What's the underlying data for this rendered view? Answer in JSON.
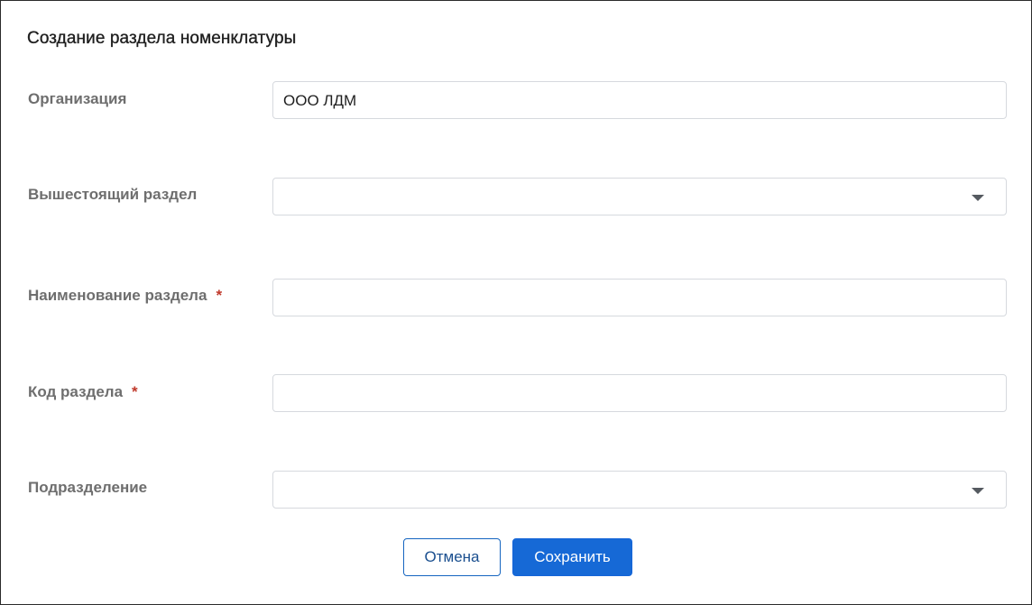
{
  "dialog": {
    "title": "Создание раздела номенклатуры"
  },
  "form": {
    "organization": {
      "label": "Организация",
      "value": "ООО ЛДМ"
    },
    "parent_section": {
      "label": "Вышестоящий раздел",
      "value": "",
      "icon": "chevron-down-icon"
    },
    "section_name": {
      "label": "Наименование раздела",
      "required_mark": "*",
      "value": ""
    },
    "section_code": {
      "label": "Код раздела",
      "required_mark": "*",
      "value": ""
    },
    "department": {
      "label": "Подразделение",
      "value": "",
      "icon": "chevron-down-icon"
    }
  },
  "actions": {
    "cancel_label": "Отмена",
    "save_label": "Сохранить"
  },
  "colors": {
    "primary": "#1669d6",
    "required": "#c0392b",
    "label": "#6e6e6e"
  }
}
